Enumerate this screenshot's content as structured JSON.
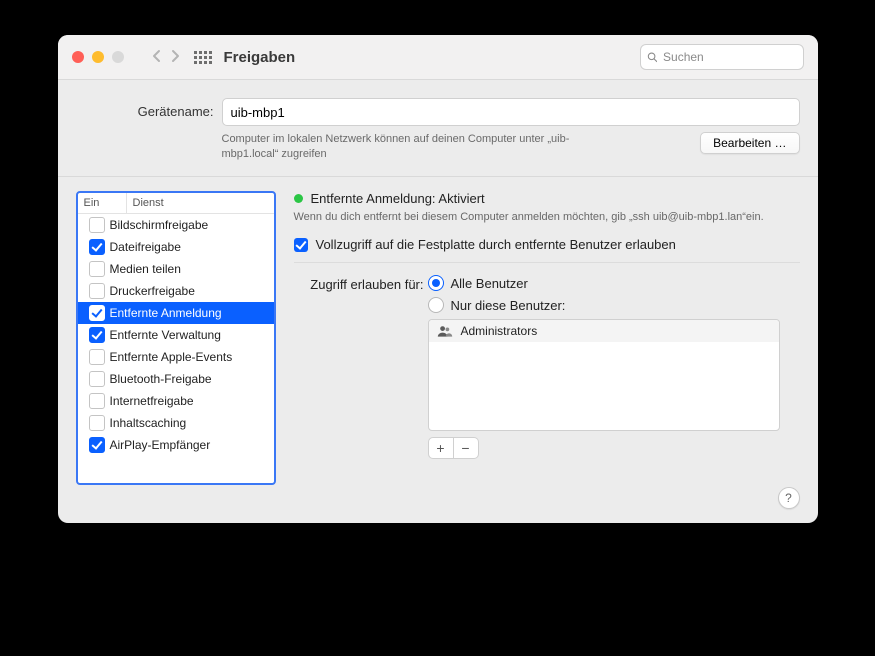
{
  "titlebar": {
    "title": "Freigaben",
    "search_placeholder": "Suchen"
  },
  "device": {
    "label": "Gerätename:",
    "name_value": "uib-mbp1",
    "help": "Computer im lokalen Netzwerk können auf deinen Computer unter „uib-mbp1.local“ zugreifen",
    "edit_button": "Bearbeiten …"
  },
  "services_header": {
    "col_on": "Ein",
    "col_service": "Dienst"
  },
  "services": [
    {
      "on": false,
      "label": "Bildschirmfreigabe",
      "selected": false
    },
    {
      "on": true,
      "label": "Dateifreigabe",
      "selected": false
    },
    {
      "on": false,
      "label": "Medien teilen",
      "selected": false
    },
    {
      "on": false,
      "label": "Druckerfreigabe",
      "selected": false
    },
    {
      "on": true,
      "label": "Entfernte Anmeldung",
      "selected": true
    },
    {
      "on": true,
      "label": "Entfernte Verwaltung",
      "selected": false
    },
    {
      "on": false,
      "label": "Entfernte Apple-Events",
      "selected": false
    },
    {
      "on": false,
      "label": "Bluetooth-Freigabe",
      "selected": false
    },
    {
      "on": false,
      "label": "Internetfreigabe",
      "selected": false
    },
    {
      "on": false,
      "label": "Inhaltscaching",
      "selected": false
    },
    {
      "on": true,
      "label": "AirPlay-Empfänger",
      "selected": false
    }
  ],
  "detail": {
    "status_text": "Entfernte Anmeldung: Aktiviert",
    "hint": "Wenn du dich entfernt bei diesem Computer anmelden möchten, gib „ssh uib@uib-mbp1.lan“ein.",
    "full_access_label": "Vollzugriff auf die Festplatte durch entfernte Benutzer erlauben",
    "access_label": "Zugriff erlauben für:",
    "radio_all": "Alle Benutzer",
    "radio_only": "Nur diese Benutzer:",
    "user_row": "Administrators"
  },
  "help_tooltip": "?"
}
